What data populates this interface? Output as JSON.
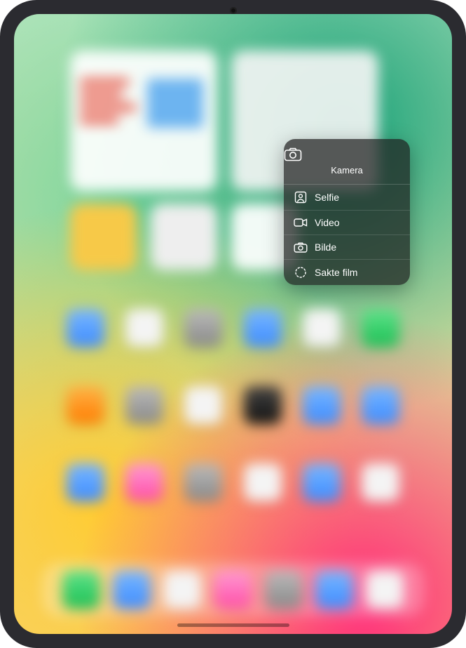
{
  "menu": {
    "title": "Kamera",
    "header_icon": "camera-icon",
    "items": [
      {
        "icon": "selfie-icon",
        "label": "Selfie"
      },
      {
        "icon": "video-icon",
        "label": "Video"
      },
      {
        "icon": "photo-icon",
        "label": "Bilde"
      },
      {
        "icon": "slomo-icon",
        "label": "Sakte film"
      }
    ]
  }
}
